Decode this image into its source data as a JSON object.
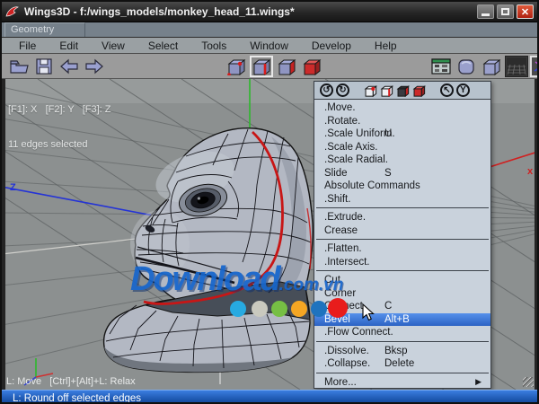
{
  "window": {
    "title": "Wings3D - f:/wings_models/monkey_head_11.wings*",
    "app_icon": "wings3d-wing-icon",
    "controls": {
      "minimize": "minimize",
      "maximize": "maximize",
      "close": "close"
    }
  },
  "tab_bar": {
    "label": "Geometry"
  },
  "menu_bar": {
    "items": [
      "File",
      "Edit",
      "View",
      "Select",
      "Tools",
      "Window",
      "Develop",
      "Help"
    ]
  },
  "toolbar": {
    "file_icons": [
      "open-folder-icon",
      "save-icon",
      "undo-arrow-icon",
      "redo-arrow-icon"
    ],
    "selection_modes": [
      "vertex-mode-icon",
      "edge-mode-icon",
      "face-mode-icon",
      "body-mode-icon"
    ],
    "active_mode": "edge-mode-icon",
    "view_icons": [
      "geometry-graph-icon",
      "smooth-shaded-icon",
      "wireframe-icon",
      "ground-plane-icon",
      "axes-icon"
    ]
  },
  "viewport": {
    "hotkeys_line": "[F1]: X   [F2]: Y   [F3]: Z",
    "selection_line": "11 edges selected",
    "axis_labels": {
      "z": "Z",
      "x": "x"
    },
    "info_line": "L: Move   [Ctrl]+[Alt]+L: Relax"
  },
  "context_menu": {
    "header_icons": [
      "repeat-icon",
      "repeat-args-icon",
      "vertex-mode-icon",
      "edge-mode-icon",
      "face-mode-icon",
      "body-mode-icon",
      "pointer-icon",
      "magnet-icon"
    ],
    "submenu_arrow": "▶",
    "items": [
      {
        "label": ".Move."
      },
      {
        "label": ".Rotate."
      },
      {
        "label": ".Scale Uniform.",
        "shortcut": "U"
      },
      {
        "label": ".Scale Axis."
      },
      {
        "label": ".Scale Radial."
      },
      {
        "label": "Slide",
        "shortcut": "S"
      },
      {
        "label": "Absolute Commands"
      },
      {
        "label": ".Shift."
      },
      {
        "separator": true
      },
      {
        "label": ".Extrude."
      },
      {
        "label": "Crease"
      },
      {
        "separator": true
      },
      {
        "label": ".Flatten."
      },
      {
        "label": ".Intersect."
      },
      {
        "separator": true
      },
      {
        "label": "Cut"
      },
      {
        "label": "Corner"
      },
      {
        "label": "Connect",
        "shortcut": "C"
      },
      {
        "label": "Bevel",
        "shortcut": "Alt+B",
        "highlighted": true
      },
      {
        "label": ".Flow Connect."
      },
      {
        "separator": true
      },
      {
        "label": ".Dissolve.",
        "shortcut": "Bksp"
      },
      {
        "label": ".Collapse.",
        "shortcut": "Delete"
      },
      {
        "separator": true
      },
      {
        "label": "More...",
        "submenu": true
      }
    ]
  },
  "status_bar": {
    "text": "L: Round off selected edges"
  },
  "watermark": {
    "text": "Download",
    "suffix": ".com.vn",
    "dot_colors": [
      "#27aae1",
      "#c9c9bf",
      "#76bf44",
      "#f5a623",
      "#1e73be",
      "#e81c1c"
    ]
  },
  "colors": {
    "menu_highlight": "#2f6cd5",
    "status_bar_blue": "#1c56ae",
    "selection_red": "#c81616",
    "watermark_blue": "#1766cc",
    "axis_x": "#d02020",
    "axis_y": "#2db82d",
    "axis_z": "#2433d6"
  }
}
